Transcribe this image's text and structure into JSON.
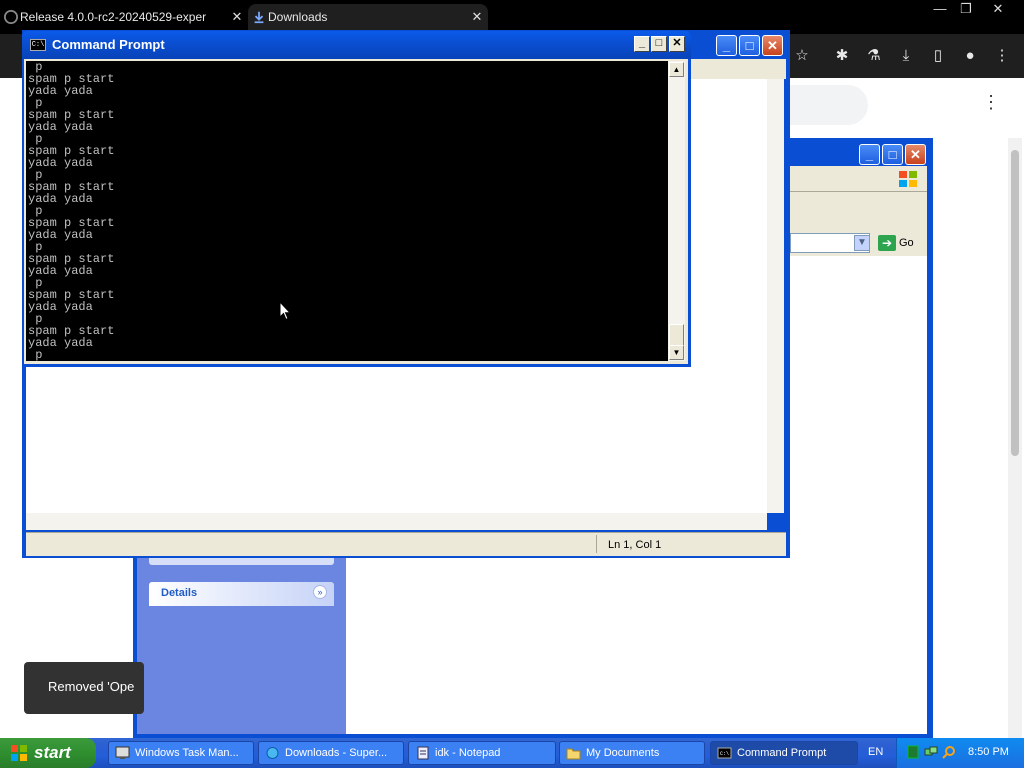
{
  "chrome": {
    "tabs": [
      {
        "title": "Release 4.0.0-rc2-20240529-exper",
        "active": false
      },
      {
        "title": "Downloads",
        "active": true
      }
    ],
    "caption": {
      "minimize": "—",
      "restore": "❐",
      "close": "✕"
    },
    "toolbar_icons": [
      "star-icon",
      "extensions-icon",
      "labs-icon",
      "download-icon",
      "sidepanel-icon",
      "profile-icon",
      "menu-icon"
    ],
    "toast_text": "Removed 'Ope"
  },
  "explorer": {
    "go_label": "Go",
    "details_label": "Details"
  },
  "notepad": {
    "status_position": "Ln 1, Col 1"
  },
  "cmd": {
    "title": "Command Prompt",
    "lines": [
      " p",
      "spam p start",
      "yada yada",
      " p",
      "spam p start",
      "yada yada",
      " p",
      "spam p start",
      "yada yada",
      " p",
      "spam p start",
      "yada yada",
      " p",
      "spam p start",
      "yada yada",
      " p",
      "spam p start",
      "yada yada",
      " p",
      "spam p start",
      "yada yada",
      " p",
      "spam p start",
      "yada yada",
      " p"
    ]
  },
  "taskbar": {
    "start_label": "start",
    "tasks": [
      {
        "label": "Windows Task Man...",
        "active": false
      },
      {
        "label": "Downloads - Super...",
        "active": false
      },
      {
        "label": "idk - Notepad",
        "active": false
      },
      {
        "label": "My Documents",
        "active": false
      },
      {
        "label": "Command Prompt",
        "active": true
      }
    ],
    "language": "EN",
    "clock": "8:50 PM"
  },
  "colors": {
    "xp_blue": "#0a4fd3",
    "taskbar_blue": "#245ed8",
    "start_green": "#2f8f2f",
    "console_bg": "#000000",
    "console_fg": "#c0c0c0"
  }
}
